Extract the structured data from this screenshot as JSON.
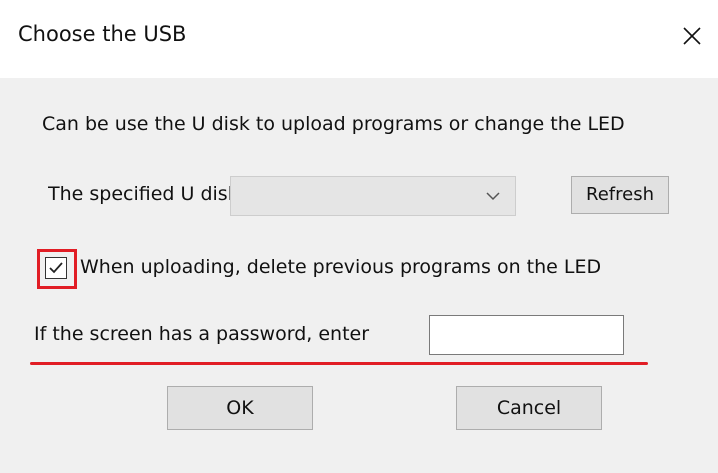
{
  "dialog": {
    "title": "Choose the USB",
    "close_icon": "close-icon",
    "description": "Can be use the U disk to upload programs or change the LED",
    "udisk_label": "The specified U disk",
    "udisk_selected": "",
    "refresh_label": "Refresh",
    "delete_checkbox_checked": true,
    "delete_label": "When uploading, delete previous programs on the LED",
    "password_label": "If the screen has a password, enter",
    "password_value": "",
    "ok_label": "OK",
    "cancel_label": "Cancel"
  },
  "colors": {
    "highlight": "#e11d25",
    "dialog_background": "#f0f0f0",
    "button_face": "#e1e1e1"
  }
}
